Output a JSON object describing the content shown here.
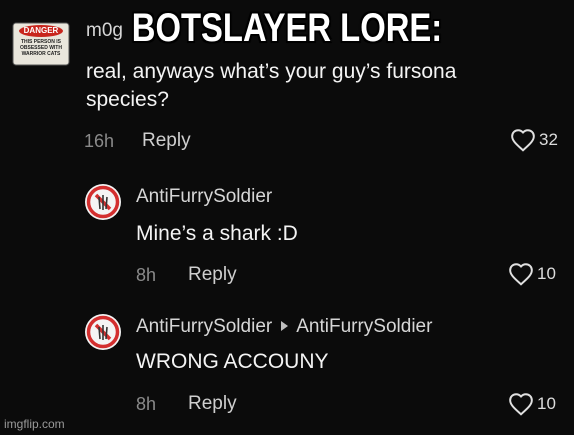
{
  "caption": "BOTSLAYER LORE:",
  "comment1": {
    "username": "m0g",
    "badge_title": "DANGER",
    "badge_text": "THIS PERSON IS OBSESSED WITH WARRIOR CATS",
    "line1": "real, anyways what’s your guy’s fursona",
    "line2": "species?",
    "time": "16h",
    "reply_label": "Reply",
    "likes": "32"
  },
  "comment2": {
    "username": "AntiFurrySoldier",
    "body": "Mine’s a shark :D",
    "time": "8h",
    "reply_label": "Reply",
    "likes": "10"
  },
  "comment3": {
    "username": "AntiFurrySoldier",
    "reply_to": "AntiFurrySoldier",
    "body": "WRONG ACCOUNY",
    "time": "8h",
    "reply_label": "Reply",
    "likes": "10"
  },
  "watermark": "imgflip.com",
  "colors": {
    "background": "#0b0b0b",
    "danger_red": "#c8251d",
    "icon_red": "#d32f2f"
  }
}
